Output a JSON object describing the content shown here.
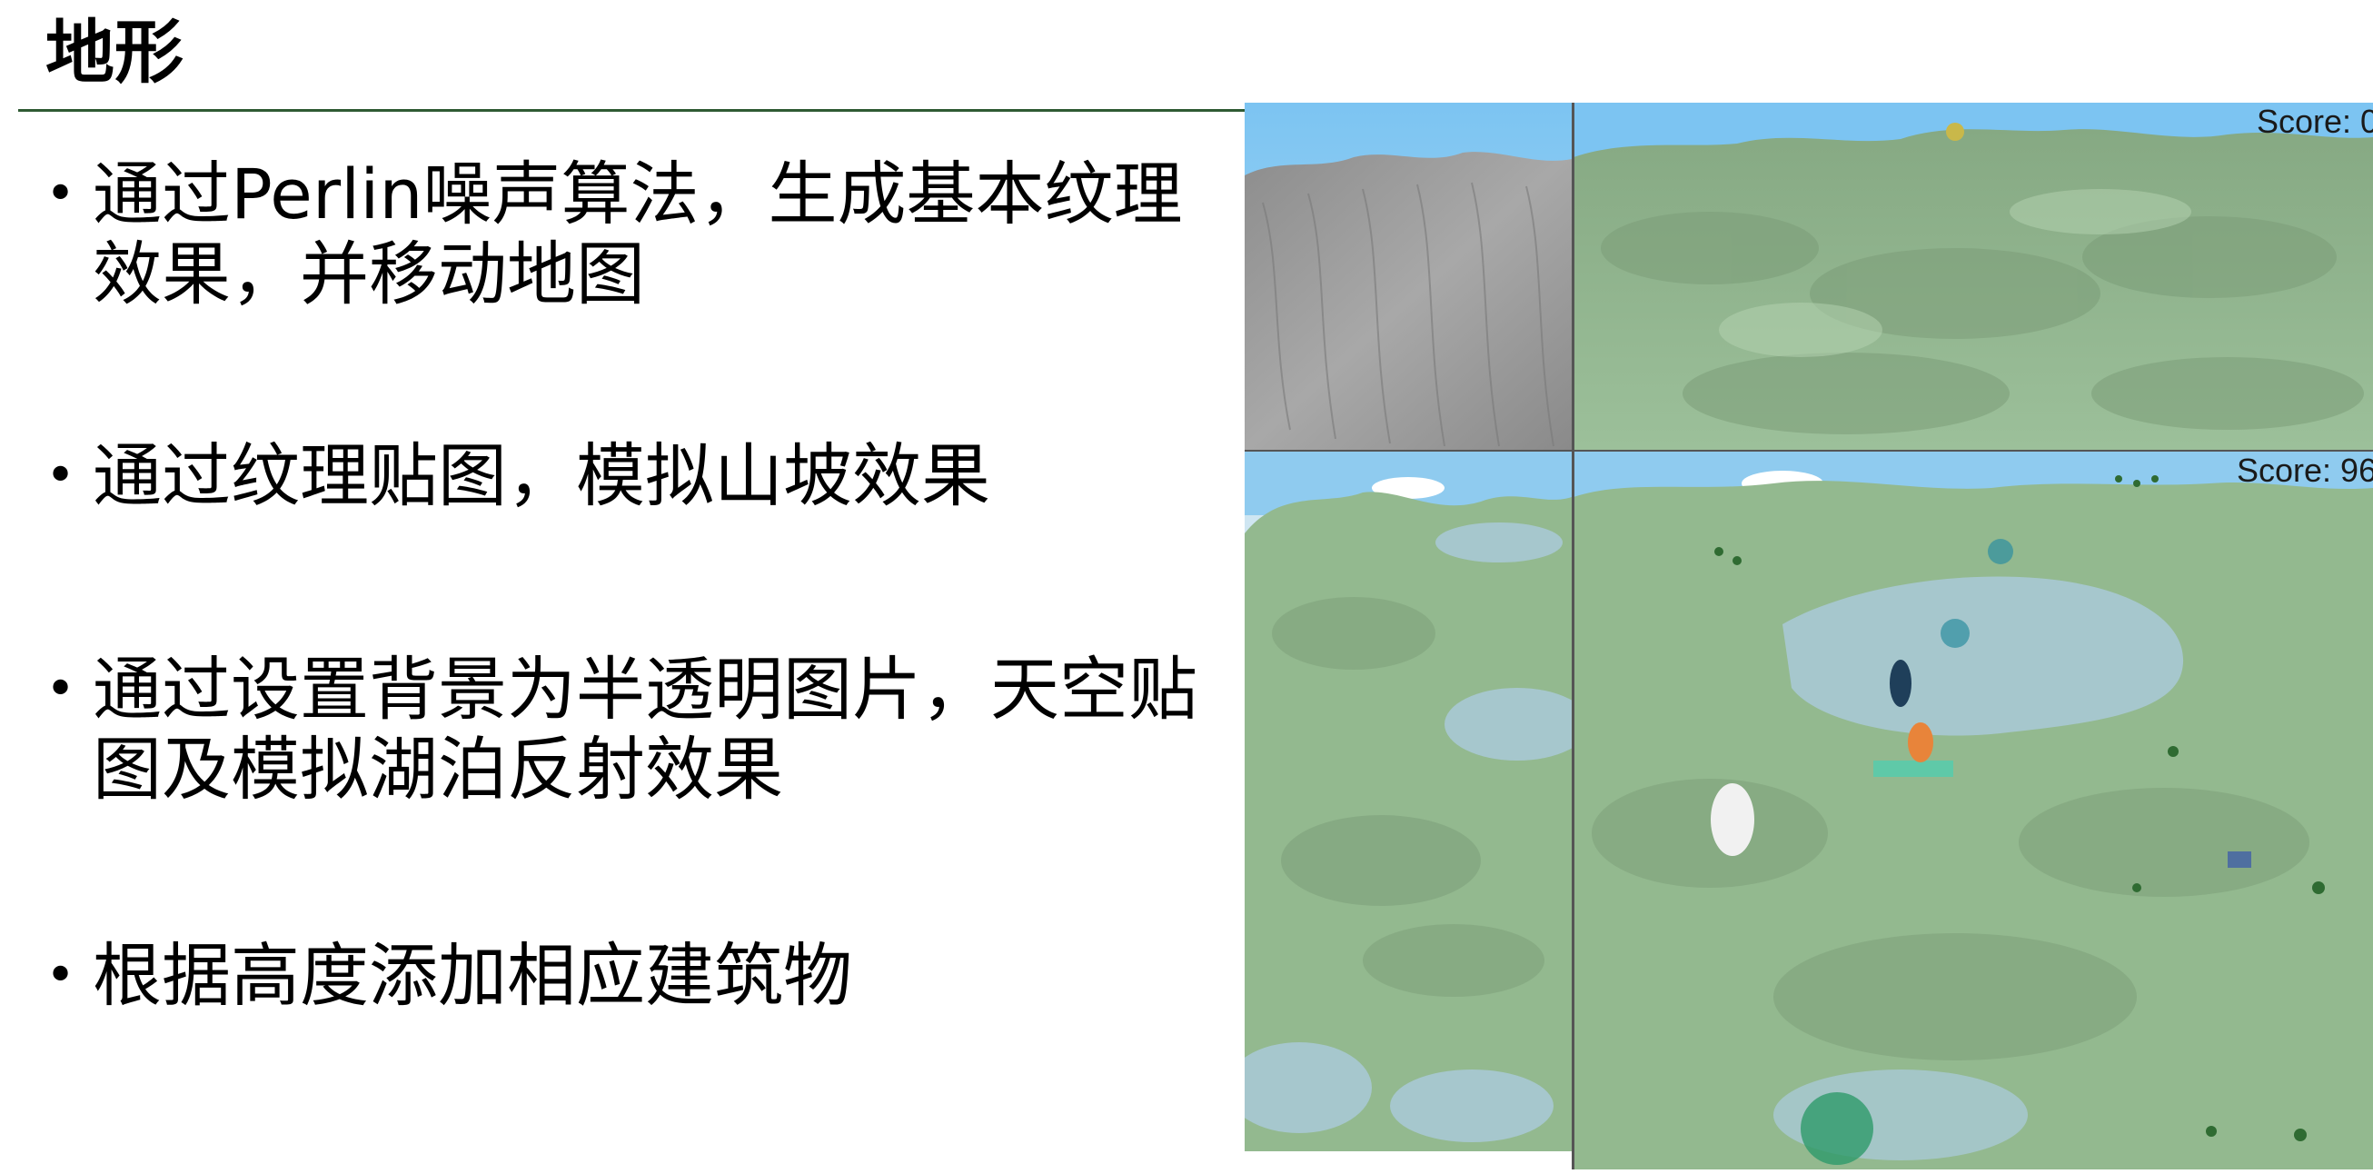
{
  "slide": {
    "title": "地形"
  },
  "bullets": [
    {
      "marker": "•",
      "text": "通过Perlin噪声算法，生成基本纹理效果，并移动地图"
    },
    {
      "marker": "•",
      "text": "通过纹理贴图，模拟山坡效果"
    },
    {
      "marker": "•",
      "text": "通过设置背景为半透明图片，天空贴图及模拟湖泊反射效果"
    },
    {
      "marker": "•",
      "text": "根据高度添加相应建筑物"
    }
  ],
  "screenshots": {
    "top_right_score": "Score: 0",
    "bottom_right_score": "Score: 96"
  },
  "colors": {
    "title_rule": "#2f5a33",
    "sky": "#7cc4f2",
    "grass": "#93b98f",
    "lake": "#a9c9d4",
    "rock_gray": "#9a9a9a"
  }
}
